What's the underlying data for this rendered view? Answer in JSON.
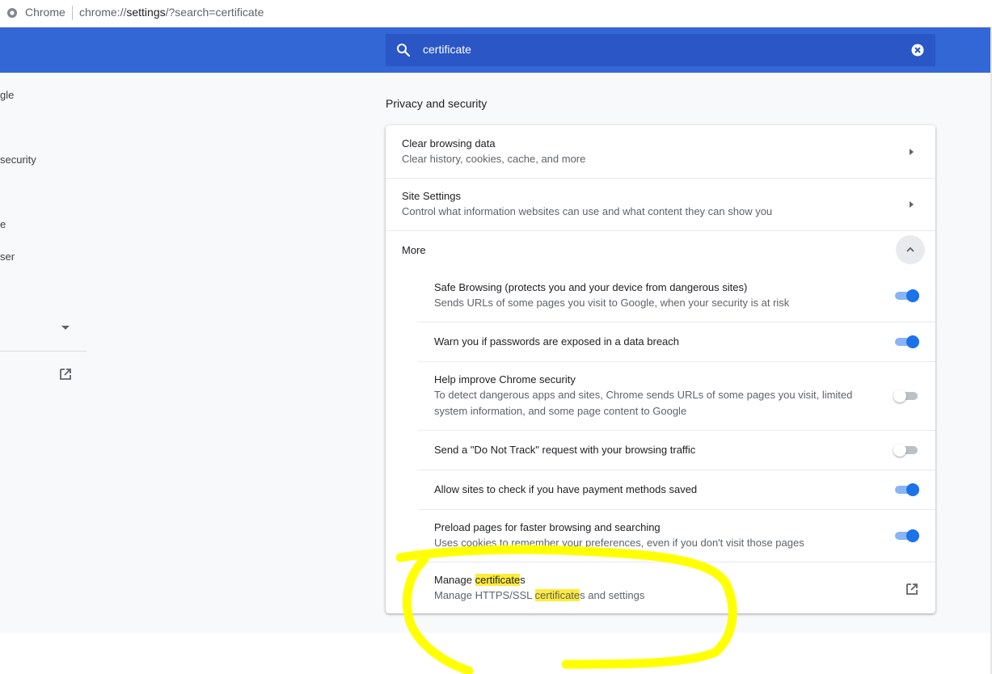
{
  "address_bar": {
    "app_name": "Chrome",
    "url_prefix": "chrome://",
    "url_host": "settings",
    "url_rest": "/?search=certificate"
  },
  "search": {
    "value": "certificate",
    "icon": "search-icon",
    "clear_icon": "clear-icon"
  },
  "sidebar": {
    "items": [
      {
        "label": "gle"
      },
      {
        "label": "security"
      },
      {
        "label": "e"
      },
      {
        "label": "ser"
      }
    ],
    "expand_icon": "caret-down-icon",
    "external_icon": "open-in-new-icon"
  },
  "privacy": {
    "section_title": "Privacy and security",
    "clear_browsing": {
      "title": "Clear browsing data",
      "subtitle": "Clear history, cookies, cache, and more"
    },
    "site_settings": {
      "title": "Site Settings",
      "subtitle": "Control what information websites can use and what content they can show you"
    },
    "more_label": "More",
    "items": [
      {
        "title": "Safe Browsing (protects you and your device from dangerous sites)",
        "subtitle": "Sends URLs of some pages you visit to Google, when your security is at risk",
        "enabled": true
      },
      {
        "title": "Warn you if passwords are exposed in a data breach",
        "enabled": true
      },
      {
        "title": "Help improve Chrome security",
        "subtitle_line1": "To detect dangerous apps and sites, Chrome sends URLs of some pages you visit, limited",
        "subtitle_line2": "system information, and some page content to Google",
        "enabled": false
      },
      {
        "title": "Send a \"Do Not Track\" request with your browsing traffic",
        "enabled": false
      },
      {
        "title": "Allow sites to check if you have payment methods saved",
        "enabled": true
      },
      {
        "title": "Preload pages for faster browsing and searching",
        "subtitle": "Uses cookies to remember your preferences, even if you don't visit those pages",
        "enabled": true
      }
    ],
    "manage_certificates": {
      "title_prefix": "Manage ",
      "title_highlight": "certificate",
      "title_suffix": "s",
      "subtitle_prefix": "Manage HTTPS/SSL ",
      "subtitle_highlight": "certificate",
      "subtitle_suffix": "s and settings"
    }
  },
  "colors": {
    "header_blue": "#3367d6",
    "search_bg": "#2a56c6",
    "toggle_on": "#1a73e8",
    "highlight": "#ffeb3b",
    "annotation": "#ffff00"
  }
}
